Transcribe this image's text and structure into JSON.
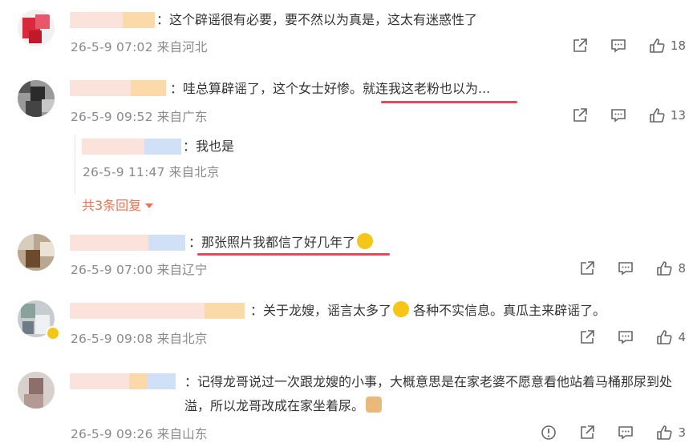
{
  "comments": [
    {
      "text": "：这个辟谣很有必要，要不然以为真是，这太有迷惑性了",
      "time": "26-5-9 07:02",
      "location": "来自河北",
      "likes": "18"
    },
    {
      "text": "：哇总算辟谣了，这个女士好惨。就连我这老粉也以为...",
      "time": "26-5-9 09:52",
      "location": "来自广东",
      "likes": "13",
      "reply": {
        "text": "：我也是",
        "time": "26-5-9 11:47",
        "location": "来自北京"
      },
      "more_replies": "共3条回复"
    },
    {
      "text": "：那张照片我都信了好几年了",
      "time": "26-5-9 07:00",
      "location": "来自辽宁",
      "likes": "8"
    },
    {
      "text": "：关于龙嫂，谣言太多了",
      "text_after": " 各种不实信息。真瓜主来辟谣了。",
      "time": "26-5-9 09:08",
      "location": "来自北京",
      "likes": "4"
    },
    {
      "text": "：记得龙哥说过一次跟龙嫂的小事，大概意思是在家老婆不愿意看他站着马桶那尿到处溢，所以龙哥改成在家坐着尿。",
      "time": "26-5-9 09:26",
      "location": "来自山东",
      "likes": "3"
    }
  ],
  "icons": {
    "share": "share-icon",
    "comment": "comment-icon",
    "like": "thumbs-up-icon",
    "more_arrow": "caret-down-icon"
  },
  "colors": {
    "highlight_underline": "#e24b5b",
    "more_replies": "#eb7350",
    "meta": "#8a8a8a"
  }
}
